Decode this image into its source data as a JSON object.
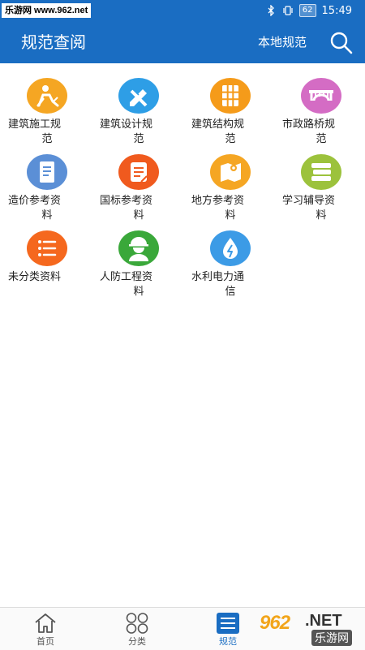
{
  "status_bar": {
    "watermark": "乐游网 www.962.net",
    "battery": "62",
    "time": "15:49"
  },
  "header": {
    "title": "规范查阅",
    "local_label": "本地规范"
  },
  "categories": [
    {
      "line1": "建筑施工规",
      "line2": "范",
      "color": "#f5a623",
      "icon": "construction-worker-icon"
    },
    {
      "line1": "建筑设计规",
      "line2": "范",
      "color": "#2e9ee6",
      "icon": "ruler-pencil-icon"
    },
    {
      "line1": "建筑结构规",
      "line2": "范",
      "color": "#f59b1a",
      "icon": "building-grid-icon"
    },
    {
      "line1": "市政路桥规",
      "line2": "范",
      "color": "#d46cc4",
      "icon": "bridge-icon"
    },
    {
      "line1": "造价参考资",
      "line2": "料",
      "color": "#5b8fd6",
      "icon": "document-icon"
    },
    {
      "line1": "国标参考资",
      "line2": "料",
      "color": "#f05a1e",
      "icon": "notepad-icon"
    },
    {
      "line1": "地方参考资",
      "line2": "料",
      "color": "#f5a623",
      "icon": "map-pin-icon"
    },
    {
      "line1": "学习辅导资",
      "line2": "料",
      "color": "#9cc23c",
      "icon": "books-icon"
    },
    {
      "line1": "未分类资料",
      "line2": "",
      "color": "#f5681e",
      "icon": "list-icon"
    },
    {
      "line1": "人防工程资",
      "line2": "料",
      "color": "#3aa83a",
      "icon": "helmet-person-icon"
    },
    {
      "line1": "水利电力通",
      "line2": "信",
      "color": "#3c9be6",
      "icon": "water-power-icon"
    }
  ],
  "bottom_nav": [
    {
      "label": "首页",
      "icon": "home-icon",
      "active": false
    },
    {
      "label": "分类",
      "icon": "grid-icon",
      "active": false
    },
    {
      "label": "规范",
      "icon": "menu-icon",
      "active": true
    }
  ],
  "logo": {
    "main": "962",
    "net": ".NET",
    "sub": "乐游网"
  }
}
